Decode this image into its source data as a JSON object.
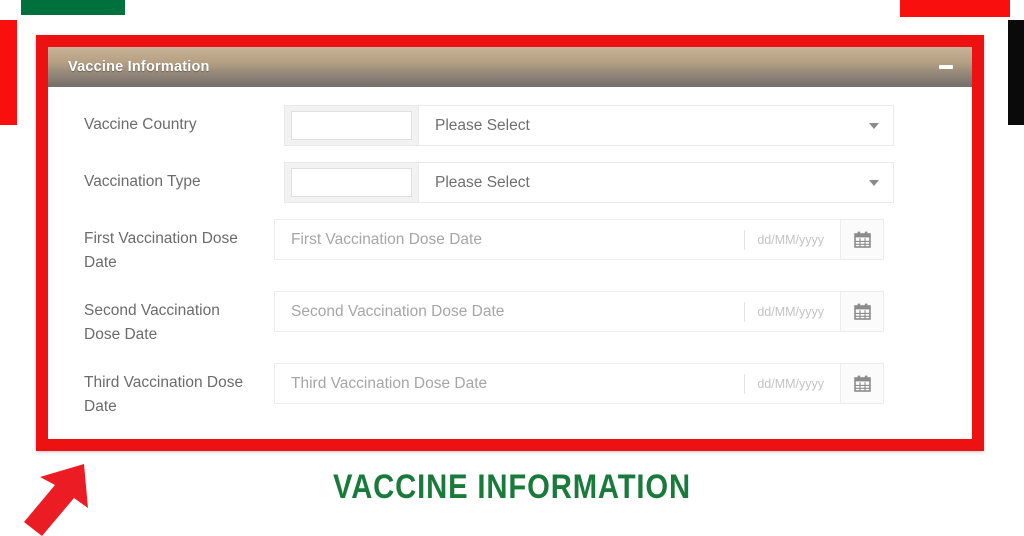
{
  "panel": {
    "title": "Vaccine Information",
    "minimize_label": "−"
  },
  "form": {
    "rows": [
      {
        "label": "Vaccine Country",
        "type": "select",
        "value": "Please Select"
      },
      {
        "label": "Vaccination Type",
        "type": "select",
        "value": "Please Select"
      },
      {
        "label": "First Vaccination Dose Date",
        "type": "date",
        "placeholder": "First Vaccination Dose Date",
        "format": "dd/MM/yyyy"
      },
      {
        "label": "Second Vaccination Dose Date",
        "type": "date",
        "placeholder": "Second Vaccination Dose Date",
        "format": "dd/MM/yyyy"
      },
      {
        "label": "Third Vaccination Dose Date",
        "type": "date",
        "placeholder": "Third Vaccination Dose Date",
        "format": "dd/MM/yyyy"
      }
    ]
  },
  "caption": {
    "text": "VACCINE INFORMATION"
  },
  "colors": {
    "frame_red": "#ee1111",
    "caption_green": "#1a7a3c",
    "deco_green": "#00703c",
    "deco_red": "#fa0f0f",
    "deco_black": "#0a0a0a",
    "header_gradient_top": "#c9b396",
    "header_gradient_bottom": "#736e68"
  },
  "icons": {
    "minimize": "minimize-icon",
    "caret": "chevron-down-icon",
    "calendar": "calendar-icon",
    "arrow": "arrow-up-right-icon"
  }
}
